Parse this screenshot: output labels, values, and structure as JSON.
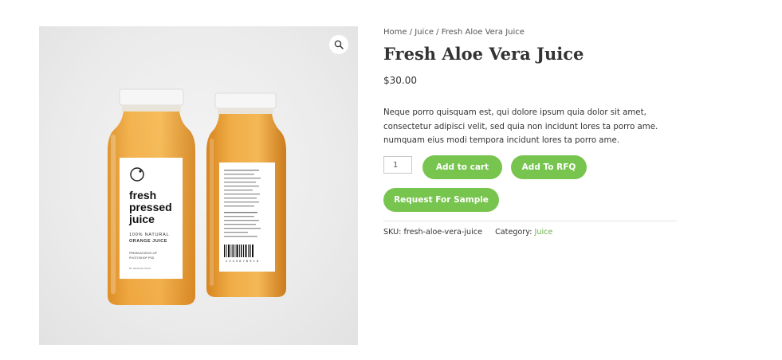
{
  "breadcrumb": {
    "home": "Home",
    "sep1": " / ",
    "category": "Juice",
    "sep2": " / ",
    "current": "Fresh Aloe Vera Juice"
  },
  "product": {
    "title": "Fresh Aloe Vera Juice",
    "price": "$30.00",
    "description": "Neque porro quisquam est, qui dolore ipsum quia dolor sit amet, consectetur adipisci velit, sed quia non incidunt lores ta porro ame. numquam eius modi tempora incidunt lores ta porro ame.",
    "quantity": "1"
  },
  "buttons": {
    "add_to_cart": "Add to cart",
    "add_to_rfq": "Add To RFQ",
    "request_sample": "Request For Sample"
  },
  "meta": {
    "sku_label": "SKU:",
    "sku_value": "fresh-aloe-vera-juice",
    "category_label": "Category:",
    "category_value": "Juice"
  },
  "image": {
    "label_front": {
      "line1": "fresh",
      "line2": "pressed",
      "line3": "juice",
      "tagline1": "100% NATURAL",
      "tagline2": "ORANGE JUICE",
      "small1": "PREMIUM MOCK-UP",
      "small2": "PHOTOSHOP PSD",
      "small3": "BY GRAPHIC PACK"
    },
    "label_back": {
      "barcode_number": "2 3 4 5 6  7 8 9 1 0"
    }
  },
  "colors": {
    "accent": "#77c54e",
    "link": "#6ab04c",
    "juice": "#f0a63a"
  },
  "icons": {
    "zoom": "magnifier-icon"
  }
}
